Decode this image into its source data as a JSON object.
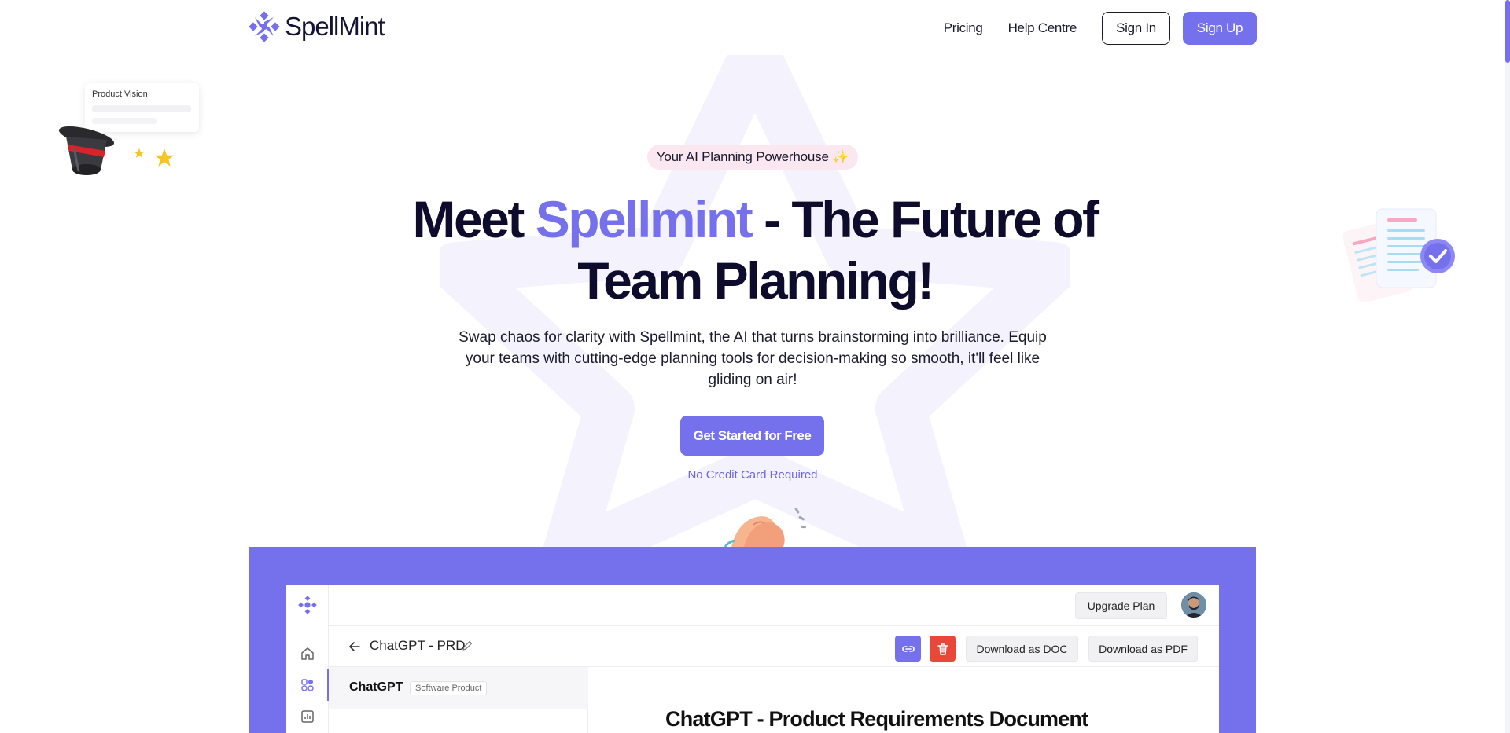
{
  "nav": {
    "brand": "SpellMint",
    "links": [
      "Pricing",
      "Help Centre"
    ],
    "sign_in": "Sign In",
    "sign_up": "Sign Up"
  },
  "decor": {
    "card_title": "Product Vision"
  },
  "hero": {
    "pill": "Your AI Planning Powerhouse ✨",
    "title_pre": "Meet ",
    "title_accent": "Spellmint",
    "title_post": " - The Future of Team Planning!",
    "subtitle": "Swap chaos for clarity with Spellmint, the AI that turns brainstorming into brilliance. Equip your teams with cutting-edge planning tools for decision-making so smooth, it'll feel like gliding on air!",
    "cta": "Get Started for Free",
    "cta_note": "No Credit Card Required"
  },
  "app_preview": {
    "upgrade": "Upgrade Plan",
    "doc_title": "ChatGPT - PRD",
    "download_doc": "Download as DOC",
    "download_pdf": "Download as PDF",
    "list_item_name": "ChatGPT",
    "list_item_tag": "Software Product",
    "doc_heading": "ChatGPT - Product Requirements Document"
  },
  "colors": {
    "brand": "#7571ec",
    "danger": "#e8473a",
    "pill_bg": "#fbe7ef"
  }
}
